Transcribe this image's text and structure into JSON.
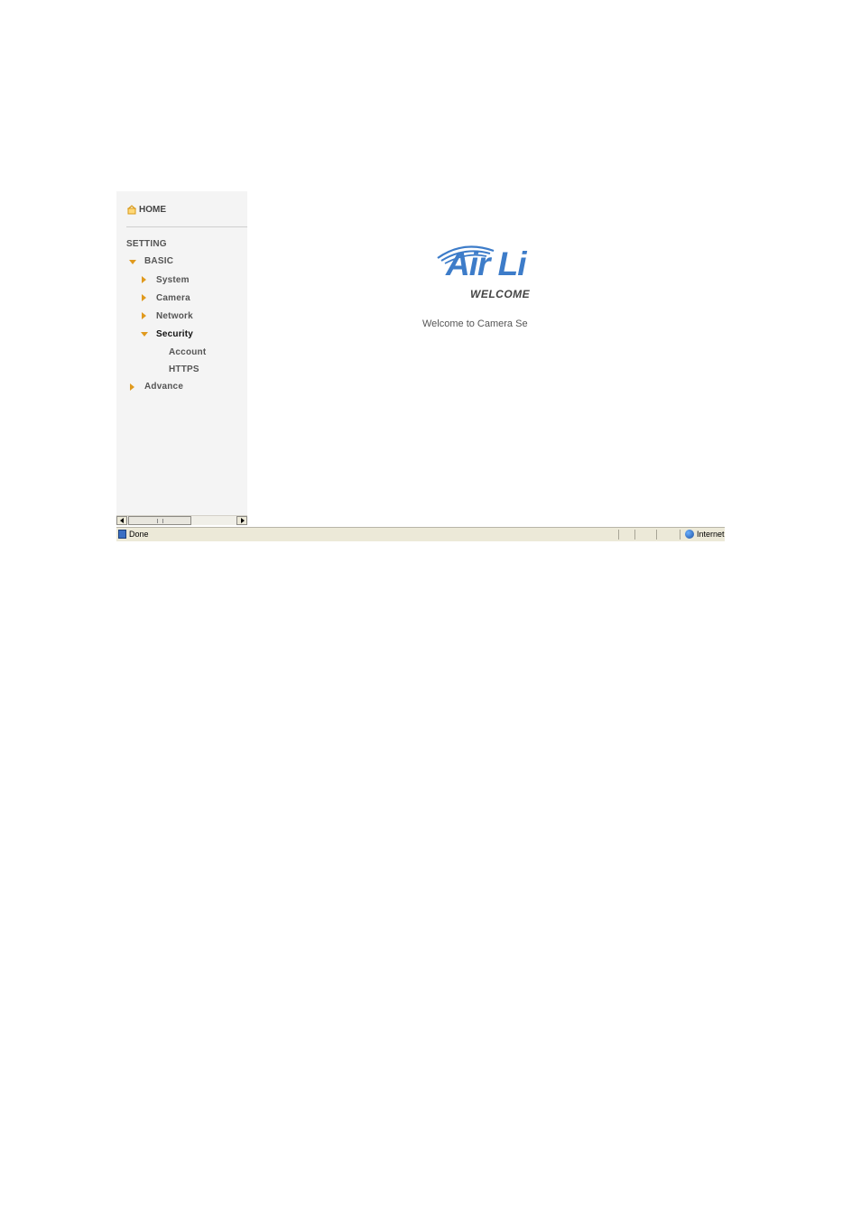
{
  "sidebar": {
    "home_label": "HOME",
    "section_label": "SETTING",
    "items": [
      {
        "label": "BASIC",
        "expanded": true
      },
      {
        "label": "System",
        "expanded": false
      },
      {
        "label": "Camera",
        "expanded": false
      },
      {
        "label": "Network",
        "expanded": false
      },
      {
        "label": "Security",
        "expanded": true,
        "active": true
      },
      {
        "label": "Account"
      },
      {
        "label": "HTTPS"
      },
      {
        "label": "Advance",
        "expanded": false
      }
    ]
  },
  "main": {
    "logo_text": "Air Li",
    "logo_subtext": "WELCOME",
    "welcome_message": "Welcome to Camera Se"
  },
  "statusbar": {
    "status": "Done",
    "zone": "Internet"
  },
  "colors": {
    "arrow": "#e09a1e",
    "logo_blue": "#3d7cc9",
    "sidebar_bg": "#f4f4f4"
  }
}
